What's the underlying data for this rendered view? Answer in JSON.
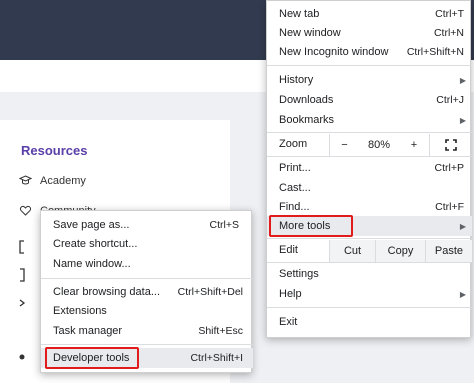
{
  "page": {
    "resources_title": "Resources",
    "resource_items": [
      {
        "label": "Academy",
        "icon": "graduation-cap-icon"
      },
      {
        "label": "Community",
        "icon": "heart-icon"
      }
    ]
  },
  "menu": {
    "items_top": [
      {
        "label": "New tab",
        "shortcut": "Ctrl+T"
      },
      {
        "label": "New window",
        "shortcut": "Ctrl+N"
      },
      {
        "label": "New Incognito window",
        "shortcut": "Ctrl+Shift+N"
      }
    ],
    "items_history": [
      {
        "label": "History",
        "shortcut": ""
      },
      {
        "label": "Downloads",
        "shortcut": "Ctrl+J"
      },
      {
        "label": "Bookmarks",
        "shortcut": ""
      }
    ],
    "zoom": {
      "label": "Zoom",
      "minus": "−",
      "value": "80%",
      "plus": "+",
      "fullscreen_icon": "fullscreen-icon"
    },
    "items_print": [
      {
        "label": "Print...",
        "shortcut": "Ctrl+P"
      },
      {
        "label": "Cast...",
        "shortcut": ""
      },
      {
        "label": "Find...",
        "shortcut": "Ctrl+F"
      },
      {
        "label": "More tools",
        "shortcut": ""
      }
    ],
    "edit": {
      "label": "Edit",
      "cut": "Cut",
      "copy": "Copy",
      "paste": "Paste"
    },
    "items_settings": [
      {
        "label": "Settings"
      },
      {
        "label": "Help"
      }
    ],
    "exit": "Exit"
  },
  "submenu": {
    "group1": [
      {
        "label": "Save page as...",
        "shortcut": "Ctrl+S"
      },
      {
        "label": "Create shortcut...",
        "shortcut": ""
      },
      {
        "label": "Name window...",
        "shortcut": ""
      }
    ],
    "group2": [
      {
        "label": "Clear browsing data...",
        "shortcut": "Ctrl+Shift+Del"
      },
      {
        "label": "Extensions",
        "shortcut": ""
      },
      {
        "label": "Task manager",
        "shortcut": "Shift+Esc"
      }
    ],
    "developer": {
      "label": "Developer tools",
      "shortcut": "Ctrl+Shift+I"
    }
  },
  "colors": {
    "highlight_box": "#e11a1a",
    "header": "#323a4f",
    "accent": "#5b3fa8"
  }
}
